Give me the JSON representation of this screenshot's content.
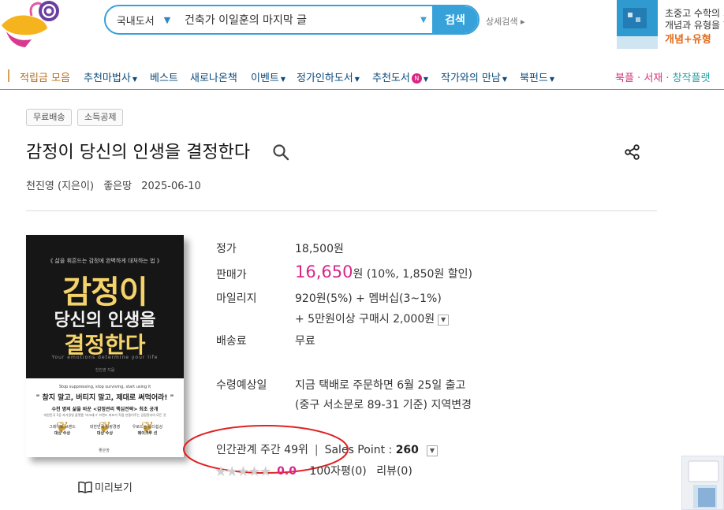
{
  "header": {
    "search": {
      "category": "국내도서",
      "query": "건축가 이일훈의 마지막 글",
      "button_label": "검색"
    },
    "detail_search": "상세검색 ▸",
    "ad": {
      "line1": "초중고 수학의 기",
      "line2": "개념과 유형을 한",
      "line3": "개념+유형"
    }
  },
  "nav": {
    "items": [
      {
        "label": "적립금 모음",
        "dropdown": false
      },
      {
        "label": "추천마법사",
        "dropdown": true
      },
      {
        "label": "베스트",
        "dropdown": false
      },
      {
        "label": "새로나온책",
        "dropdown": false
      },
      {
        "label": "이벤트",
        "dropdown": true
      },
      {
        "label": "정가인하도서",
        "dropdown": true
      },
      {
        "label": "추천도서",
        "dropdown": true,
        "badge": "N"
      },
      {
        "label": "작가와의 만남",
        "dropdown": true
      },
      {
        "label": "북펀드",
        "dropdown": true
      }
    ],
    "right": {
      "bookple": "북플 · ",
      "shelf": "서재 · ",
      "creator": "창작플랫"
    }
  },
  "book": {
    "tags": [
      "무료배송",
      "소득공제"
    ],
    "title": "감정이 당신의 인생을 결정한다",
    "author": "천진영 (지은이)",
    "publisher": "좋은땅",
    "date": "2025-06-10",
    "cover": {
      "subtitle": "《 삶을 휘흔드는 감정에 완벽하게 대처하는 법 》",
      "title_line1": "감정이",
      "title_line2": "당신의 인생을",
      "title_line3": "결정한다",
      "english": "Your emotions determine your life",
      "author": "천진영 지음",
      "tagline_en": "Stop suppressing, stop surviving, start using it",
      "slogan": "\" 참지 말고, 버티지 말고, 제대로 써먹어라! \"",
      "blurb": "수천 명의 삶을 바꾼 <감정관리 핵심전략> 최초 공개",
      "blurb_small": "대한민국 1등 자기경영 플랫폼 '비크레그' 브랜드 파포가 직접 만들어주는 감정관리의 모든 것",
      "awards": [
        {
          "top": "그레이트 브랜드",
          "bottom": "대상 수상"
        },
        {
          "top": "대한민국 자랑경영",
          "bottom": "대상 수상"
        },
        {
          "top": "우로드는 리더쉽상",
          "bottom": "메이크루 선"
        }
      ],
      "publisher": "좋은땅"
    },
    "preview_label": "미리보기"
  },
  "pricing": {
    "list_price_label": "정가",
    "list_price": "18,500원",
    "sale_price_label": "판매가",
    "sale_price": "16,650",
    "sale_price_unit": "원",
    "discount": "(10%, 1,850원 할인)",
    "mileage_label": "마일리지",
    "mileage": "920원(5%) + 멤버십(3~1%)",
    "mileage_extra": "+ 5만원이상 구매시 2,000원",
    "shipping_label": "배송료",
    "shipping": "무료",
    "delivery_label": "수령예상일",
    "delivery_line1": "지금 택배로 주문하면 6월 25일 출고",
    "delivery_line2": "(중구 서소문로 89-31 기준) 지역변경"
  },
  "stats": {
    "rank": "인간관계 주간 49위",
    "sales_point_label": "Sales Point : ",
    "sales_point": "260",
    "rating_score": "0.0",
    "reviews_100": "100자평(0)",
    "reviews": "리뷰(0)",
    "stars_filled": 0,
    "stars_total": 5
  },
  "colors": {
    "accent_blue": "#37a2da",
    "price_pink": "#d9268a",
    "annotation_red": "#e02020"
  }
}
